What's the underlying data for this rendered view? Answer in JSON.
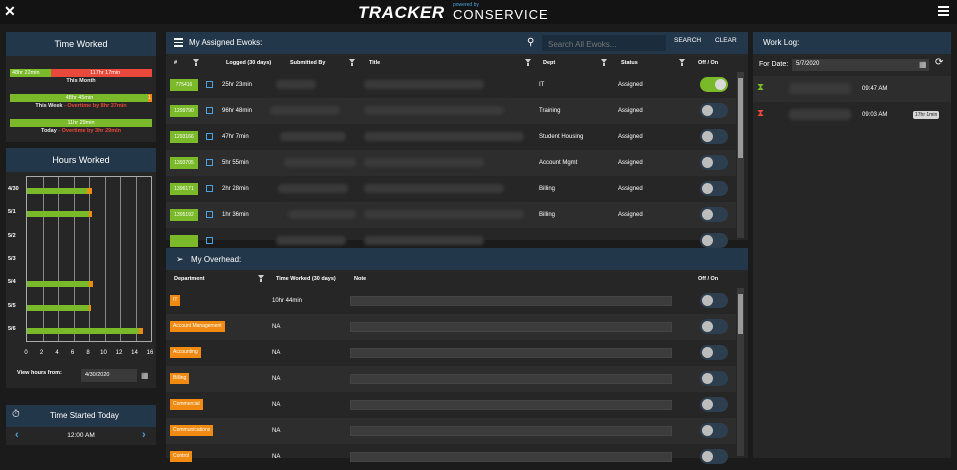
{
  "header": {
    "brand_main": "TRACKER",
    "brand_powered": "powered by",
    "brand_company": "CONSERVICE"
  },
  "time_worked": {
    "title": "Time Worked",
    "month_left": "48hr 22min",
    "month_right": "117hr 17min",
    "month_caption": "This Month",
    "week_bar": "48hr 45min",
    "week_bar_end": "1",
    "week_caption": "This Week",
    "week_overtime": " - Overtime by 8hr 37min",
    "today_bar": "11hr 29min",
    "today_caption": "Today",
    "today_overtime": " - Overtime by 3hr 29min"
  },
  "hours_worked": {
    "title": "Hours Worked",
    "view_from_label": "View hours from:",
    "view_from_value": "4/30/2020"
  },
  "chart_data": {
    "type": "bar",
    "orientation": "horizontal",
    "stacked": true,
    "categories": [
      "4/30",
      "5/1",
      "5/2",
      "5/3",
      "5/4",
      "5/5",
      "5/6"
    ],
    "series": [
      {
        "color": "#7ab929",
        "values": [
          7.8,
          8.0,
          0,
          0,
          8.0,
          8.0,
          14.5
        ]
      },
      {
        "color": "#f08a10",
        "values": [
          0.6,
          0.4,
          0,
          0,
          0.5,
          0.3,
          0.5
        ]
      }
    ],
    "xlim": [
      0,
      16
    ],
    "xticks": [
      0,
      2,
      4,
      6,
      8,
      10,
      12,
      14,
      16
    ]
  },
  "time_started": {
    "title": "Time Started Today",
    "value": "12:00 AM"
  },
  "assigned": {
    "title": "My Assigned Ewoks:",
    "search_placeholder": "Search All Ewoks...",
    "search_btn": "SEARCH",
    "clear_btn": "CLEAR",
    "columns": {
      "num": "#",
      "logged": "Logged (30 days)",
      "submitted": "Submitted By",
      "title": "Title",
      "dept": "Dept",
      "status": "Status",
      "offon": "Off / On"
    },
    "rows": [
      {
        "id": "775416",
        "logged": "25hr 23min",
        "dept": "IT",
        "status": "Assigned",
        "on": true
      },
      {
        "id": "1299790",
        "logged": "96hr 48min",
        "dept": "Training",
        "status": "Assigned",
        "on": false
      },
      {
        "id": "1293166",
        "logged": "47hr 7min",
        "dept": "Student Housing",
        "status": "Assigned",
        "on": false
      },
      {
        "id": "1393705",
        "logged": "5hr 55min",
        "dept": "Account Mgmt",
        "status": "Assigned",
        "on": false
      },
      {
        "id": "1396171",
        "logged": "2hr 28min",
        "dept": "Billing",
        "status": "Assigned",
        "on": false
      },
      {
        "id": "1395192",
        "logged": "1hr 36min",
        "dept": "Billing",
        "status": "Assigned",
        "on": false
      },
      {
        "id": "",
        "logged": "",
        "dept": "",
        "status": "",
        "on": false
      }
    ]
  },
  "overhead": {
    "title": "My Overhead:",
    "columns": {
      "dept": "Department",
      "time": "Time Worked (30 days)",
      "note": "Note",
      "offon": "Off / On"
    },
    "rows": [
      {
        "dept": "IT",
        "time": "10hr 44min"
      },
      {
        "dept": "Account Management",
        "time": "NA"
      },
      {
        "dept": "Accounting",
        "time": "NA"
      },
      {
        "dept": "Billing",
        "time": "NA"
      },
      {
        "dept": "Commercial",
        "time": "NA"
      },
      {
        "dept": "Communications",
        "time": "NA"
      },
      {
        "dept": "Control",
        "time": "NA"
      }
    ]
  },
  "work_log": {
    "title": "Work Log:",
    "for_date_label": "For Date:",
    "for_date_value": "5/7/2020",
    "entries": [
      {
        "time": "09:47 AM",
        "badge": "",
        "color": "#7ab929"
      },
      {
        "time": "09:03 AM",
        "badge": "17hr 1min",
        "color": "#e8493a"
      }
    ]
  },
  "colors": {
    "accent_green": "#7ab929",
    "accent_orange": "#f08a10",
    "accent_blue": "#4aa3df",
    "header_navy": "#23374a",
    "alert_red": "#e8493a"
  }
}
